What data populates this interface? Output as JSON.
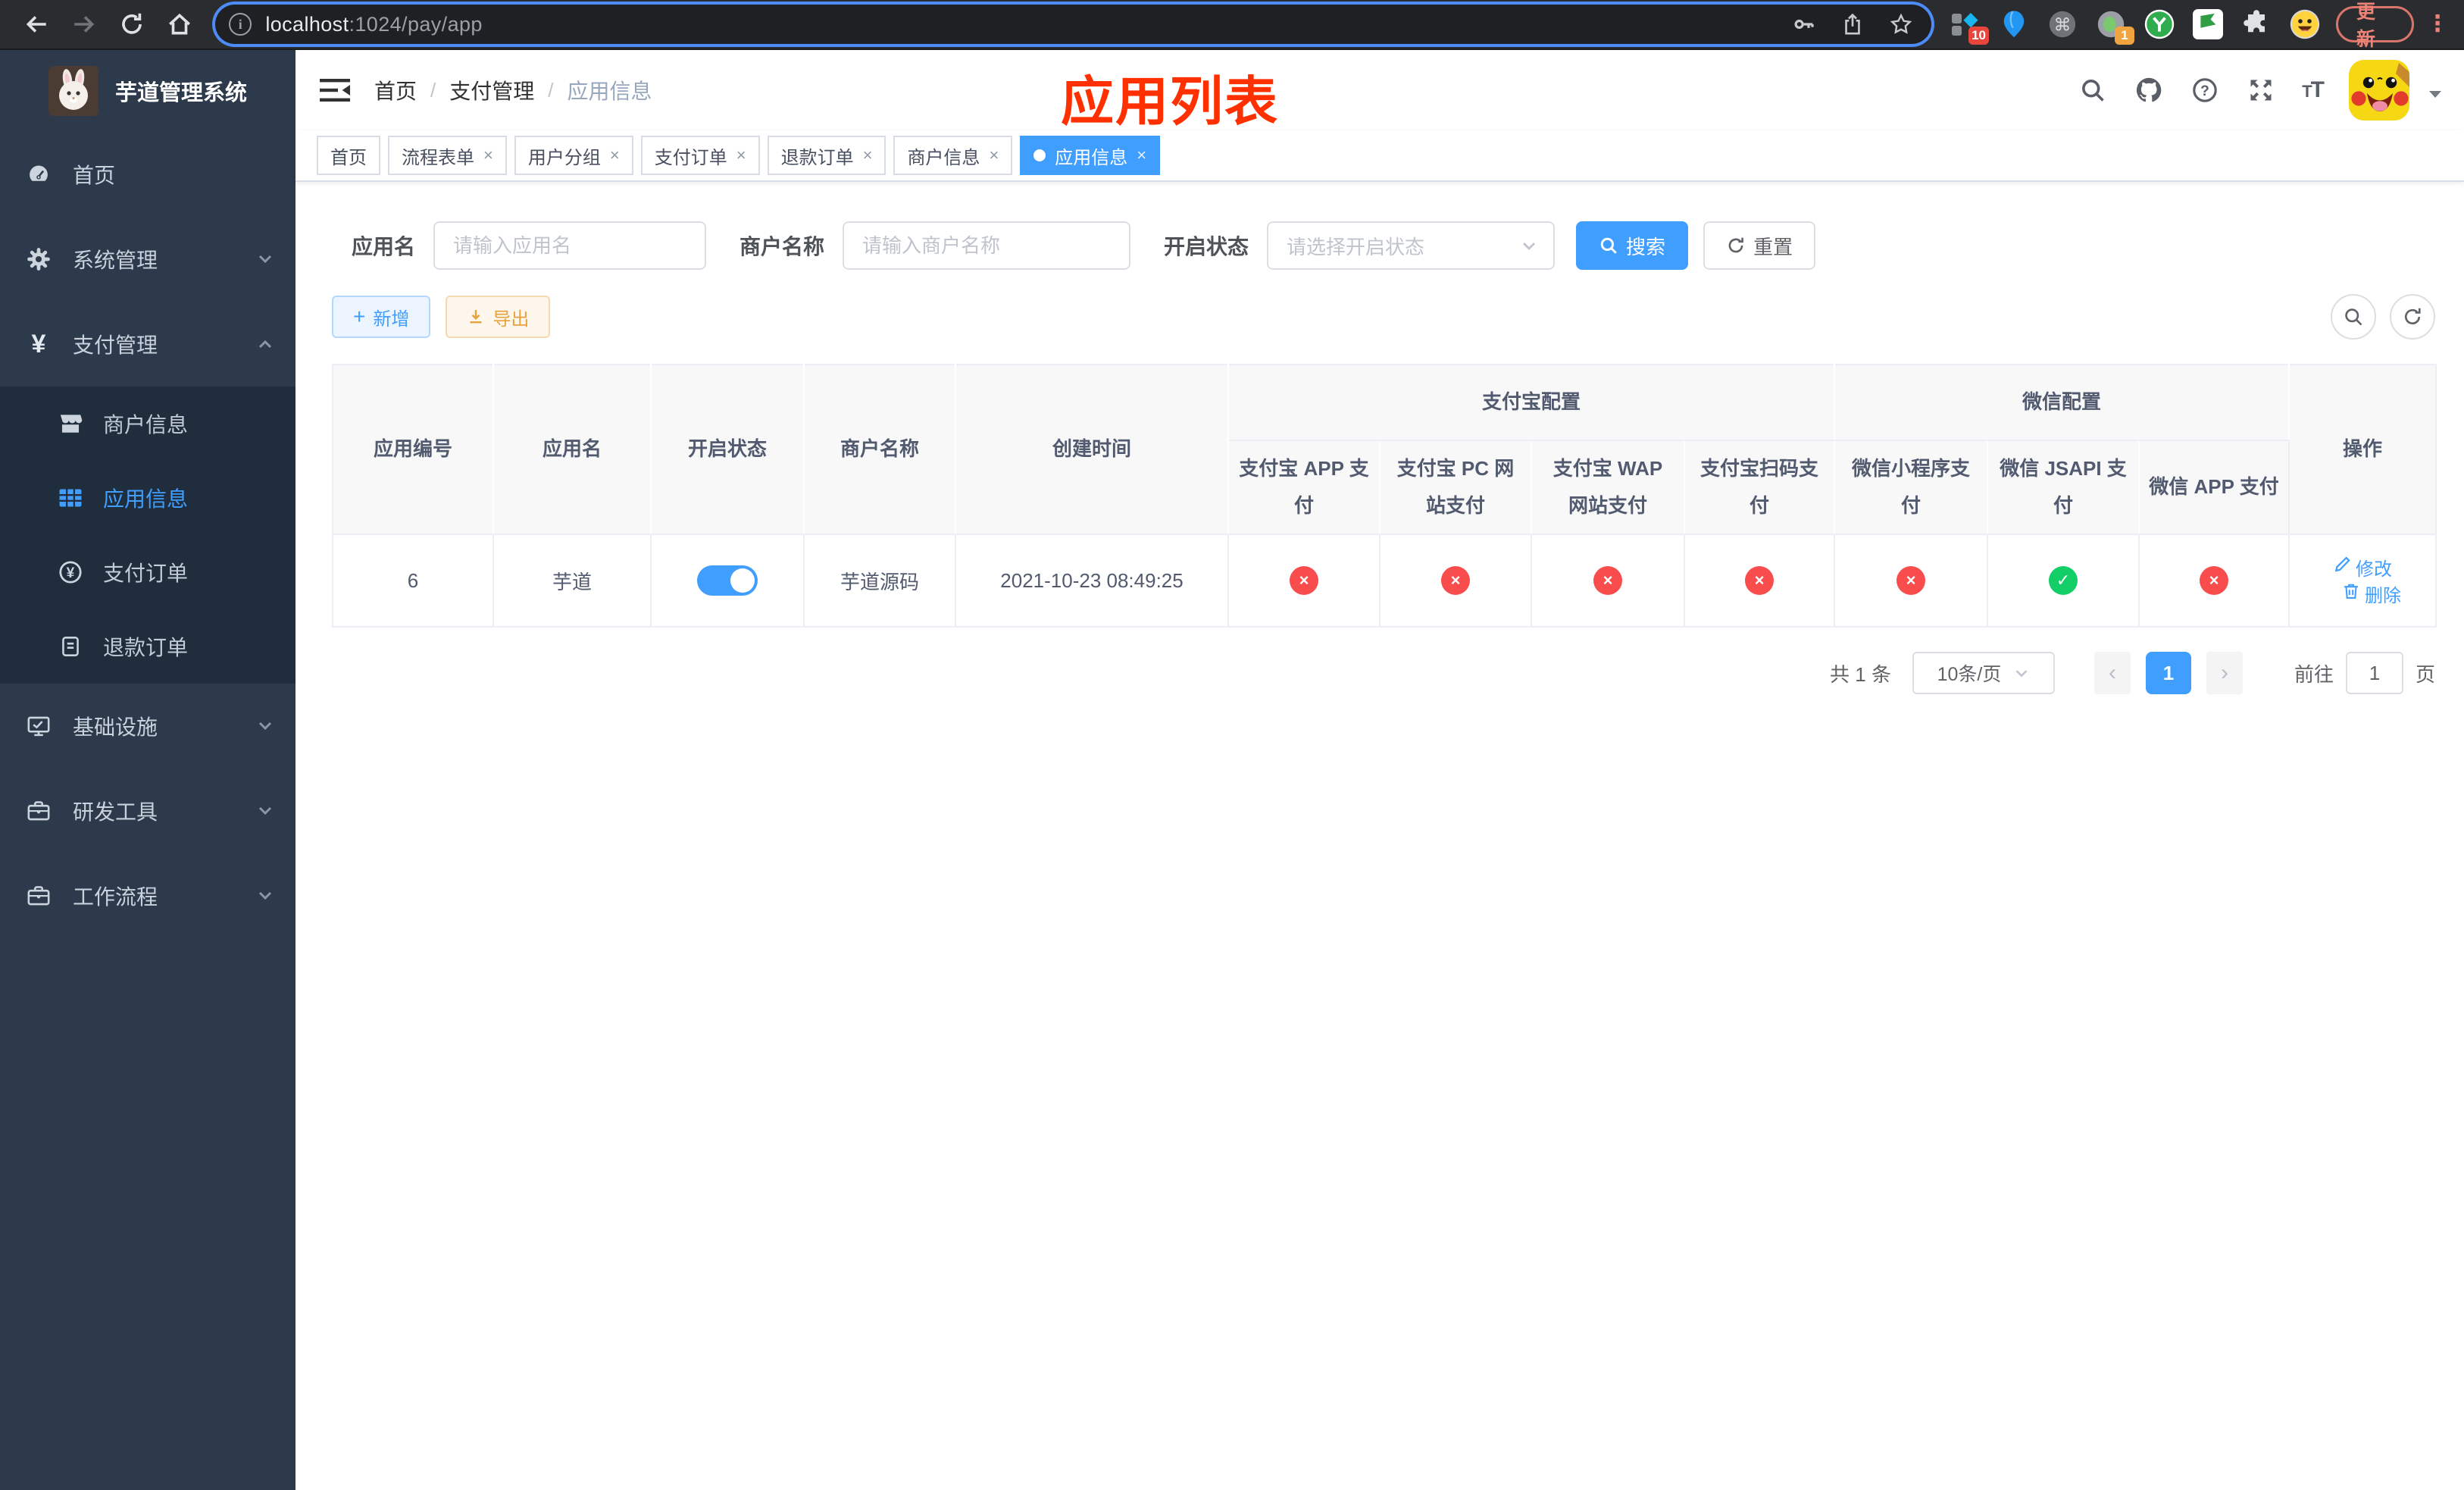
{
  "browser": {
    "url_host": "localhost",
    "url_rest": ":1024/pay/app",
    "update_label": "更新",
    "menu_dots": "⋮",
    "ext_badge_blocks": "10",
    "ext_badge_session": "1"
  },
  "sidebar": {
    "logo_title": "芋道管理系统",
    "items": [
      {
        "name": "home",
        "label": "首页",
        "icon": "dashboard",
        "sub": false,
        "active": false,
        "chevron": null
      },
      {
        "name": "system-mgmt",
        "label": "系统管理",
        "icon": "gear",
        "sub": false,
        "active": false,
        "chevron": "down"
      },
      {
        "name": "pay-mgmt",
        "label": "支付管理",
        "icon": "yen",
        "sub": false,
        "active": false,
        "chevron": "up"
      },
      {
        "name": "merchant-info",
        "label": "商户信息",
        "icon": "shop",
        "sub": true,
        "active": false,
        "chevron": null
      },
      {
        "name": "app-info",
        "label": "应用信息",
        "icon": "grid",
        "sub": true,
        "active": true,
        "chevron": null
      },
      {
        "name": "pay-order",
        "label": "支付订单",
        "icon": "yencircle",
        "sub": true,
        "active": false,
        "chevron": null
      },
      {
        "name": "refund-order",
        "label": "退款订单",
        "icon": "doc",
        "sub": true,
        "active": false,
        "chevron": null
      },
      {
        "name": "infrastructure",
        "label": "基础设施",
        "icon": "monitor",
        "sub": false,
        "active": false,
        "chevron": "down"
      },
      {
        "name": "dev-tools",
        "label": "研发工具",
        "icon": "briefcase",
        "sub": false,
        "active": false,
        "chevron": "down"
      },
      {
        "name": "workflow",
        "label": "工作流程",
        "icon": "briefcase",
        "sub": false,
        "active": false,
        "chevron": "down"
      }
    ]
  },
  "header": {
    "breadcrumb": [
      "首页",
      "支付管理",
      "应用信息"
    ],
    "page_title": "应用列表",
    "font_icon_small": "T",
    "font_icon_big": "T"
  },
  "tabs": {
    "items": [
      {
        "name": "home",
        "label": "首页",
        "closable": false,
        "active": false
      },
      {
        "name": "flow-form",
        "label": "流程表单",
        "closable": true,
        "active": false
      },
      {
        "name": "user-group",
        "label": "用户分组",
        "closable": true,
        "active": false
      },
      {
        "name": "pay-order",
        "label": "支付订单",
        "closable": true,
        "active": false
      },
      {
        "name": "refund-order",
        "label": "退款订单",
        "closable": true,
        "active": false
      },
      {
        "name": "merchant-info",
        "label": "商户信息",
        "closable": true,
        "active": false
      },
      {
        "name": "app-info",
        "label": "应用信息",
        "closable": true,
        "active": true
      }
    ],
    "close_symbol": "×"
  },
  "filters": {
    "app_name_label": "应用名",
    "app_name_placeholder": "请输入应用名",
    "merchant_label": "商户名称",
    "merchant_placeholder": "请输入商户名称",
    "status_label": "开启状态",
    "status_placeholder": "请选择开启状态",
    "search_label": "搜索",
    "reset_label": "重置"
  },
  "toolbar": {
    "add_label": "新增",
    "add_plus": "+",
    "export_label": "导出"
  },
  "table": {
    "main_cols": [
      "应用编号",
      "应用名",
      "开启状态",
      "商户名称",
      "创建时间"
    ],
    "groups": [
      {
        "label": "支付宝配置",
        "span": 4
      },
      {
        "label": "微信配置",
        "span": 3
      }
    ],
    "pay_cols": [
      "支付宝 APP 支付",
      "支付宝 PC 网站支付",
      "支付宝 WAP 网站支付",
      "支付宝扫码支付",
      "微信小程序支付",
      "微信 JSAPI 支付",
      "微信 APP 支付"
    ],
    "op_col": "操作",
    "row": {
      "id": "6",
      "name": "芋道",
      "enabled": true,
      "merchant": "芋道源码",
      "created_at": "2021-10-23 08:49:25",
      "statuses": [
        false,
        false,
        false,
        false,
        false,
        true,
        false
      ]
    },
    "edit_label": "修改",
    "delete_label": "删除",
    "cross_symbol": "×",
    "check_symbol": "✓"
  },
  "pagination": {
    "total": "共 1 条",
    "page_size": "10条/页",
    "prev_symbol": "‹",
    "next_symbol": "›",
    "current": "1",
    "goto_label": "前往",
    "goto_value": "1",
    "unit_label": "页"
  },
  "colors": {
    "accent": "#409eff",
    "danger": "#f94c4c",
    "success": "#13ce66",
    "warning": "#e6a23c",
    "title_red": "#ff3000",
    "sidebar_bg": "#2d3a4b",
    "submenu_bg": "#1f2d3d"
  }
}
